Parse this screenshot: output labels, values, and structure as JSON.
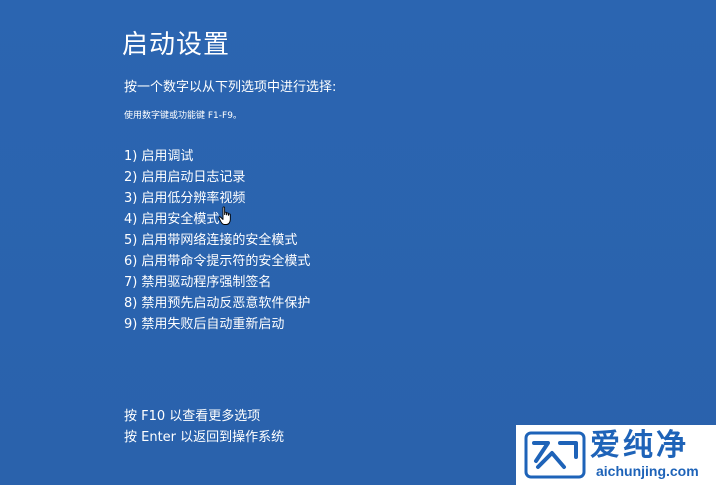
{
  "title": "启动设置",
  "subtitle": "按一个数字以从下列选项中进行选择:",
  "hint": "使用数字键或功能键 F1-F9。",
  "options": [
    {
      "number": "1)",
      "label": "启用调试"
    },
    {
      "number": "2)",
      "label": "启用启动日志记录"
    },
    {
      "number": "3)",
      "label": "启用低分辨率视频"
    },
    {
      "number": "4)",
      "label": "启用安全模式"
    },
    {
      "number": "5)",
      "label": "启用带网络连接的安全模式"
    },
    {
      "number": "6)",
      "label": "启用带命令提示符的安全模式"
    },
    {
      "number": "7)",
      "label": "禁用驱动程序强制签名"
    },
    {
      "number": "8)",
      "label": "禁用预先启动反恶意软件保护"
    },
    {
      "number": "9)",
      "label": "禁用失败后自动重新启动"
    }
  ],
  "footer": {
    "more_options": "按 F10 以查看更多选项",
    "return_os": "按 Enter 以返回到操作系统"
  },
  "cursor_icon": "hand-pointer-icon",
  "watermark": {
    "name": "爱纯净",
    "url": "aichunjing.com",
    "logo_icon": "aichunjing-logo-icon"
  },
  "colors": {
    "background": "#2a63ae",
    "text": "#ffffff",
    "watermark_brand": "#1e63b8"
  }
}
